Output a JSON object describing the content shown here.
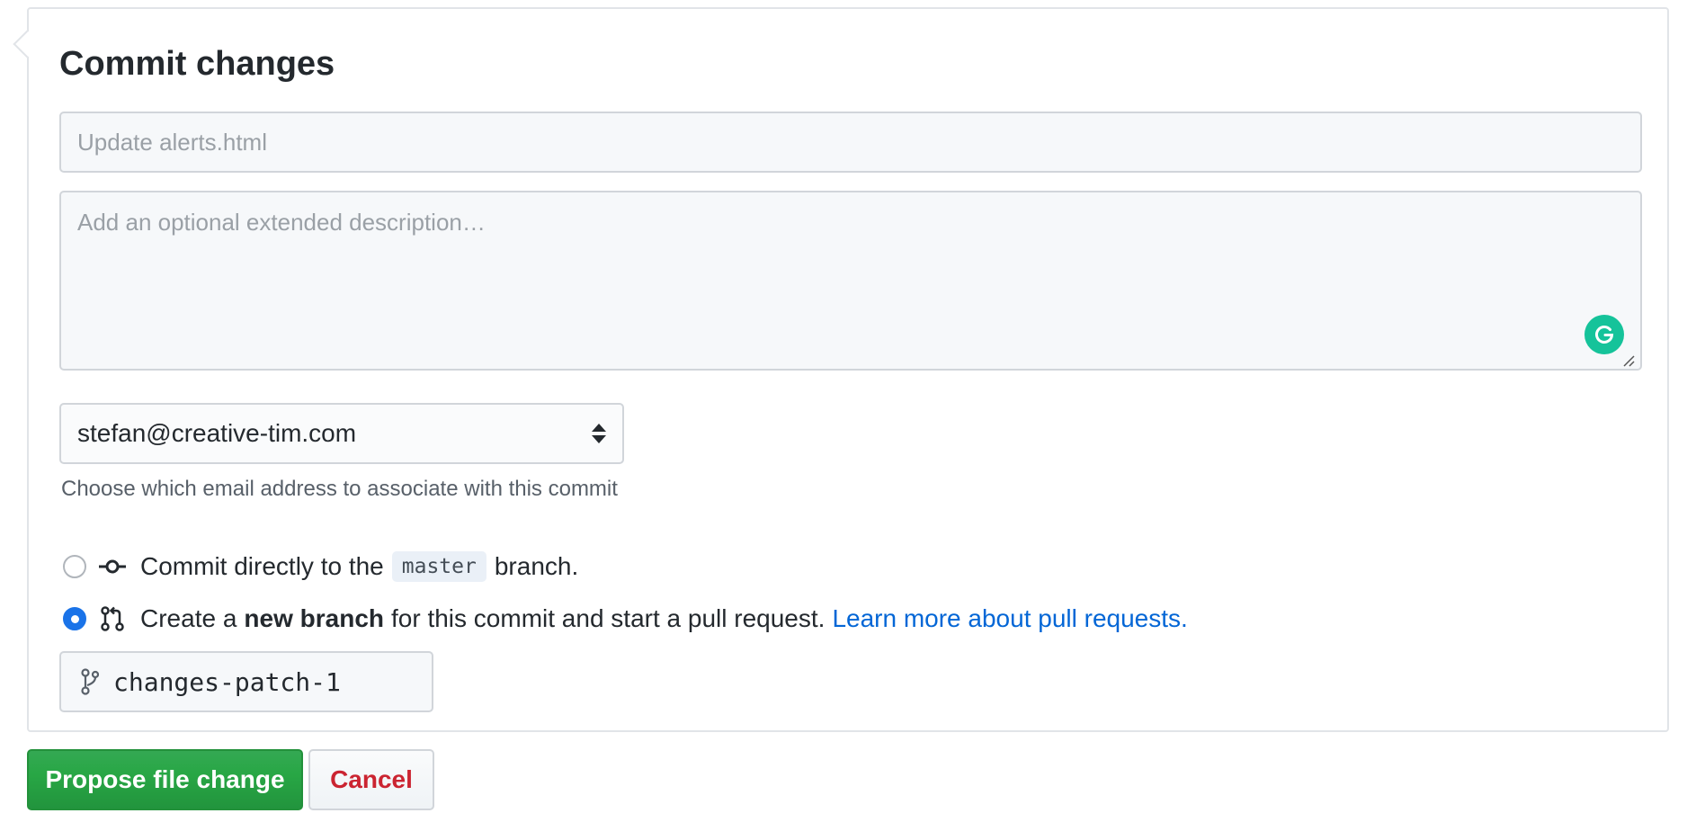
{
  "commit_form": {
    "title": "Commit changes",
    "summary_placeholder": "Update alerts.html",
    "description_placeholder": "Add an optional extended description…",
    "grammarly_icon": "grammarly-g-icon",
    "email": {
      "selected": "stefan@creative-tim.com",
      "note": "Choose which email address to associate with this commit"
    },
    "options": {
      "direct": {
        "prefix": "Commit directly to the",
        "branch": "master",
        "suffix": "branch.",
        "icon": "git-commit-icon",
        "selected": false
      },
      "new_branch": {
        "prefix": "Create a",
        "bold": "new branch",
        "suffix": "for this commit and start a pull request.",
        "link": "Learn more about pull requests.",
        "icon": "git-pull-request-icon",
        "selected": true
      }
    },
    "branch_name": "changes-patch-1",
    "branch_icon": "git-branch-icon"
  },
  "actions": {
    "propose_label": "Propose file change",
    "cancel_label": "Cancel"
  },
  "colors": {
    "propose_button": "#28a745",
    "cancel_text": "#cb2431",
    "link": "#0366d6",
    "radio_selected": "#1a73e8",
    "grammarly": "#15c39a"
  }
}
